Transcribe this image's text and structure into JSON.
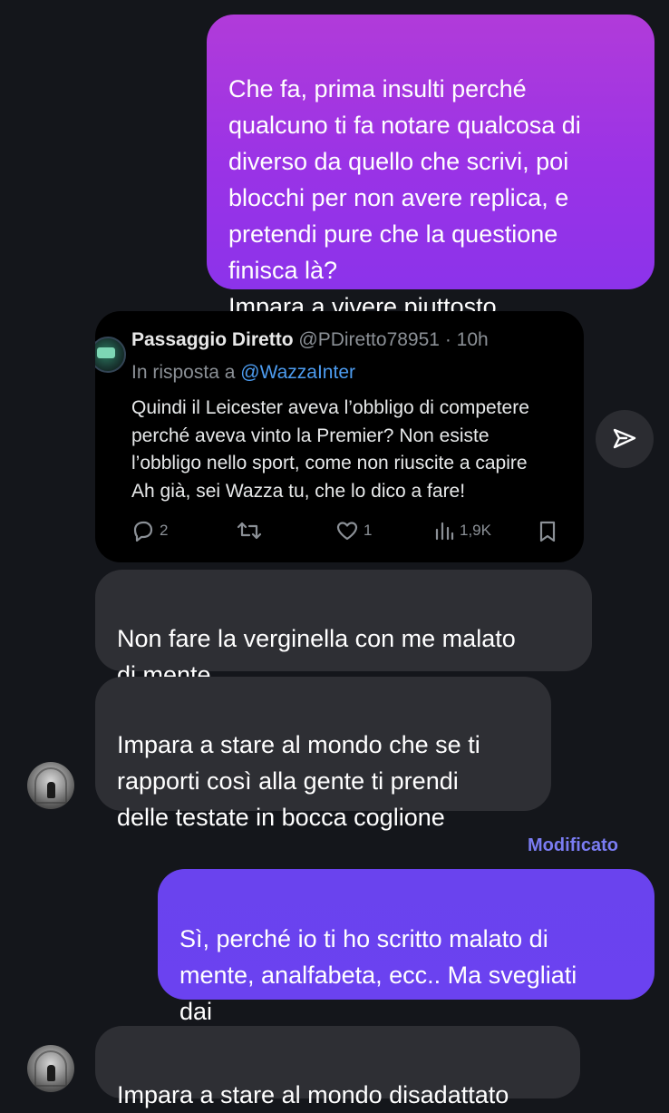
{
  "messages": {
    "sent_1": {
      "text": "Che fa, prima insulti perché\nqualcuno ti fa notare qualcosa di\ndiverso da quello che scrivi, poi\nblocchi per non avere replica, e\npretendi pure che la questione\nfinisca là?\nImpara a vivere piuttosto"
    },
    "received_1": {
      "text": "Non fare la verginella con me malato\ndi mente"
    },
    "received_2": {
      "text": "Impara a stare al mondo che se ti\nrapporti così alla gente ti prendi\ndelle testate in bocca coglione"
    },
    "edited_label": "Modificato",
    "sent_2": {
      "text": "Sì, perché io ti ho scritto malato di\nmente, analfabeta, ecc.. Ma svegliati\ndai"
    },
    "received_3": {
      "text": "Impara a stare al mondo disadattato"
    }
  },
  "tweet": {
    "author_name": "Passaggio Diretto",
    "author_handle": "@PDiretto78951",
    "separator": "·",
    "time": "10h",
    "reply_prefix": "In risposta a",
    "reply_to": "@WazzaInter",
    "text": "Quindi il Leicester aveva l’obbligo di competere\nperché aveva vinto la Premier? Non esiste\nl’obbligo nello sport, come non riuscite a capire\nAh già, sei Wazza tu, che lo dico a fare!",
    "replies": "2",
    "likes": "1",
    "views": "1,9K"
  },
  "icons": {
    "reply": "reply-icon",
    "retweet": "retweet-icon",
    "like": "heart-icon",
    "views": "views-icon",
    "bookmark": "bookmark-icon",
    "share": "send-icon"
  },
  "colors": {
    "background": "#14161b",
    "sent_gradient_top": "#b13bd9",
    "sent_gradient_bottom": "#8c33ea",
    "sent_blue": "#6a43ee",
    "received": "#2e2f34",
    "link": "#4d9cf0",
    "edited": "#7a7cf2"
  }
}
